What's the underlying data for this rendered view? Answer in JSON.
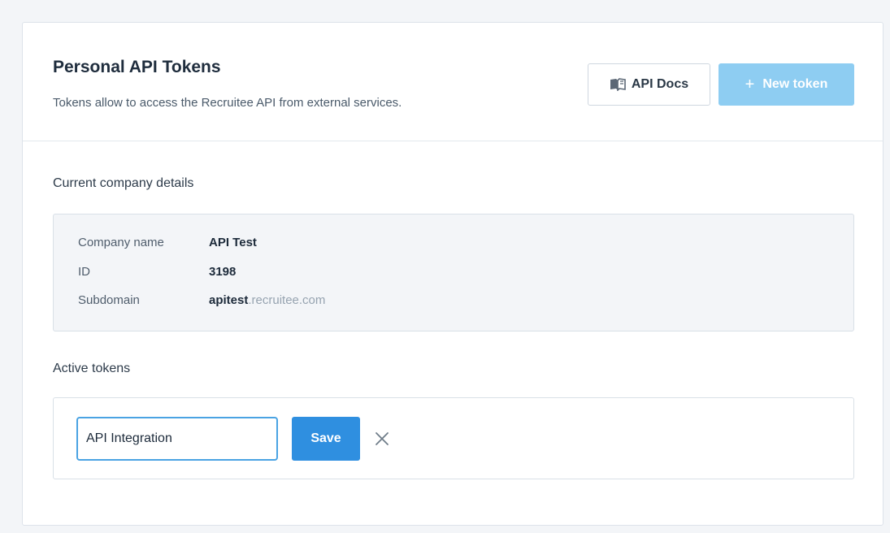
{
  "header": {
    "title": "Personal API Tokens",
    "subtitle": "Tokens allow to access the Recruitee API from external services.",
    "docs_button": {
      "label": "API Docs",
      "icon": "book-icon"
    },
    "new_token_button": {
      "label": "New token",
      "icon": "plus-icon"
    }
  },
  "company": {
    "section_label": "Current company details",
    "rows": [
      {
        "key": "Company name",
        "value": "API Test"
      },
      {
        "key": "ID",
        "value": "3198"
      },
      {
        "key": "Subdomain",
        "value": "apitest",
        "suffix": ".recruitee.com"
      }
    ]
  },
  "tokens": {
    "section_label": "Active tokens",
    "input_value": "API Integration",
    "save_label": "Save",
    "close_icon": "close-icon"
  },
  "colors": {
    "primary": "#2f8fe0",
    "primary_disabled": "#8ecdf2",
    "input_focus": "#4aa3e3",
    "panel_bg": "#f3f5f8"
  }
}
